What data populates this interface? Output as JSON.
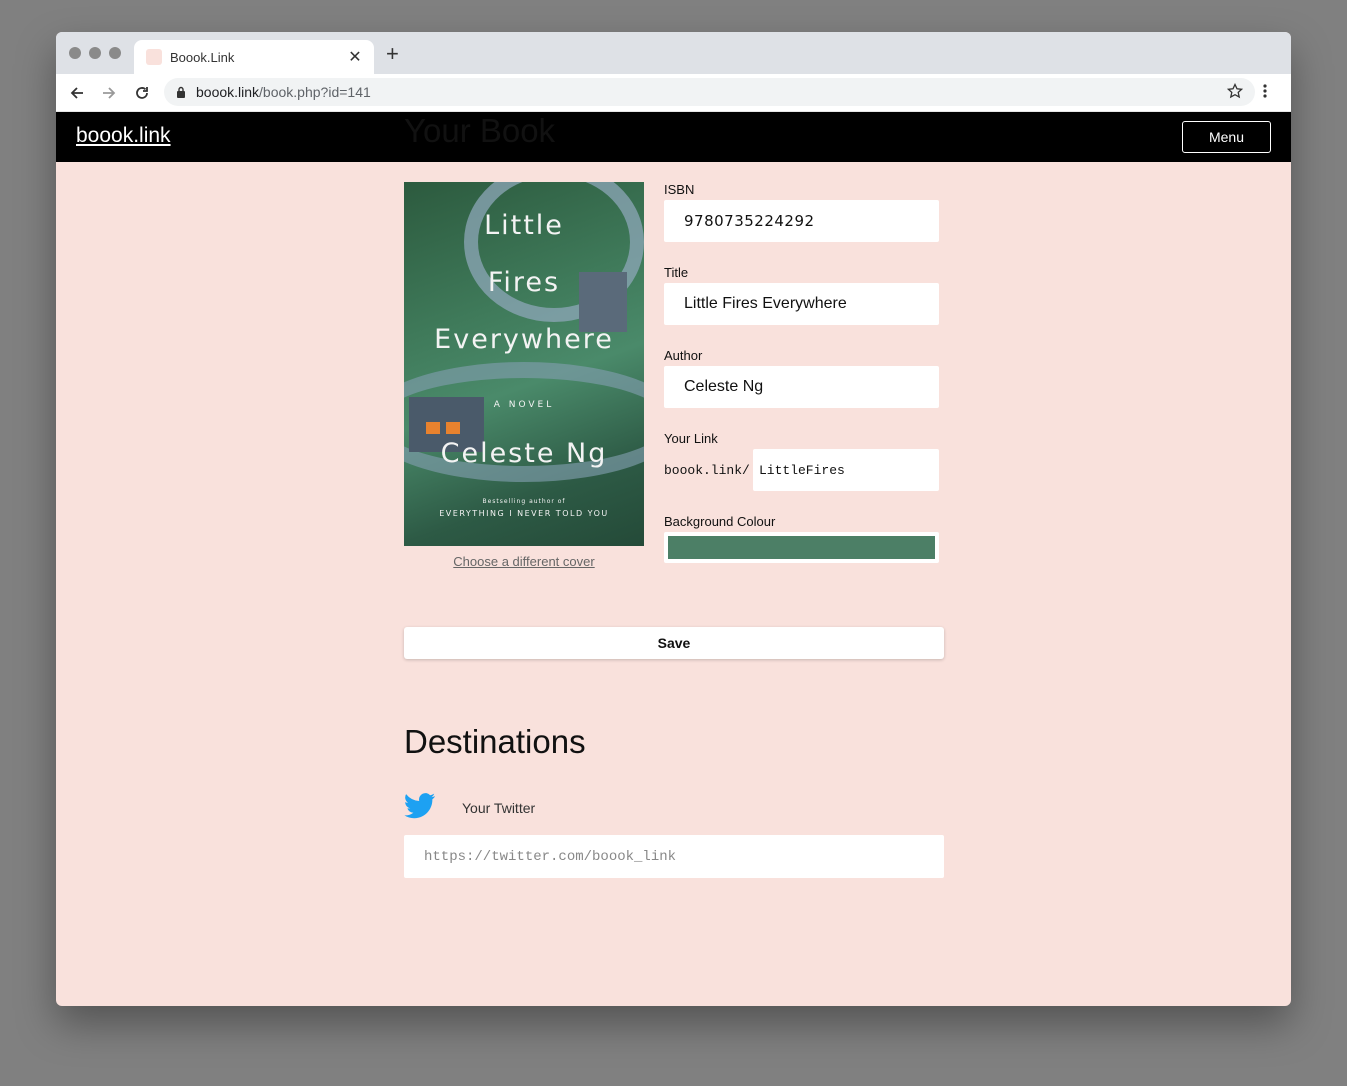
{
  "browser": {
    "tab_title": "Boook.Link",
    "url_host": "boook.link",
    "url_path": "/book.php?id=141"
  },
  "site": {
    "logo": "boook.link",
    "menu_label": "Menu"
  },
  "book": {
    "heading": "Your Book",
    "cover": {
      "line1": "Little",
      "line2": "Fires",
      "line3": "Everywhere",
      "line4": "A NOVEL",
      "line5": "Celeste Ng",
      "line6": "Bestselling author of",
      "line7": "EVERYTHING I NEVER TOLD YOU"
    },
    "choose_cover_label": "Choose a different cover",
    "isbn_label": "ISBN",
    "isbn_value": "9780735224292",
    "title_label": "Title",
    "title_value": "Little Fires Everywhere",
    "author_label": "Author",
    "author_value": "Celeste Ng",
    "link_label": "Your Link",
    "link_prefix": "boook.link/",
    "link_value": "LittleFires",
    "colour_label": "Background Colour",
    "colour_value": "#4c7f66",
    "save_label": "Save"
  },
  "destinations": {
    "heading": "Destinations",
    "twitter_label": "Your Twitter",
    "twitter_placeholder": "https://twitter.com/boook_link"
  },
  "colors": {
    "page_background": "#f9e1dc",
    "header_background": "#000000",
    "twitter_blue": "#1da1f2"
  }
}
